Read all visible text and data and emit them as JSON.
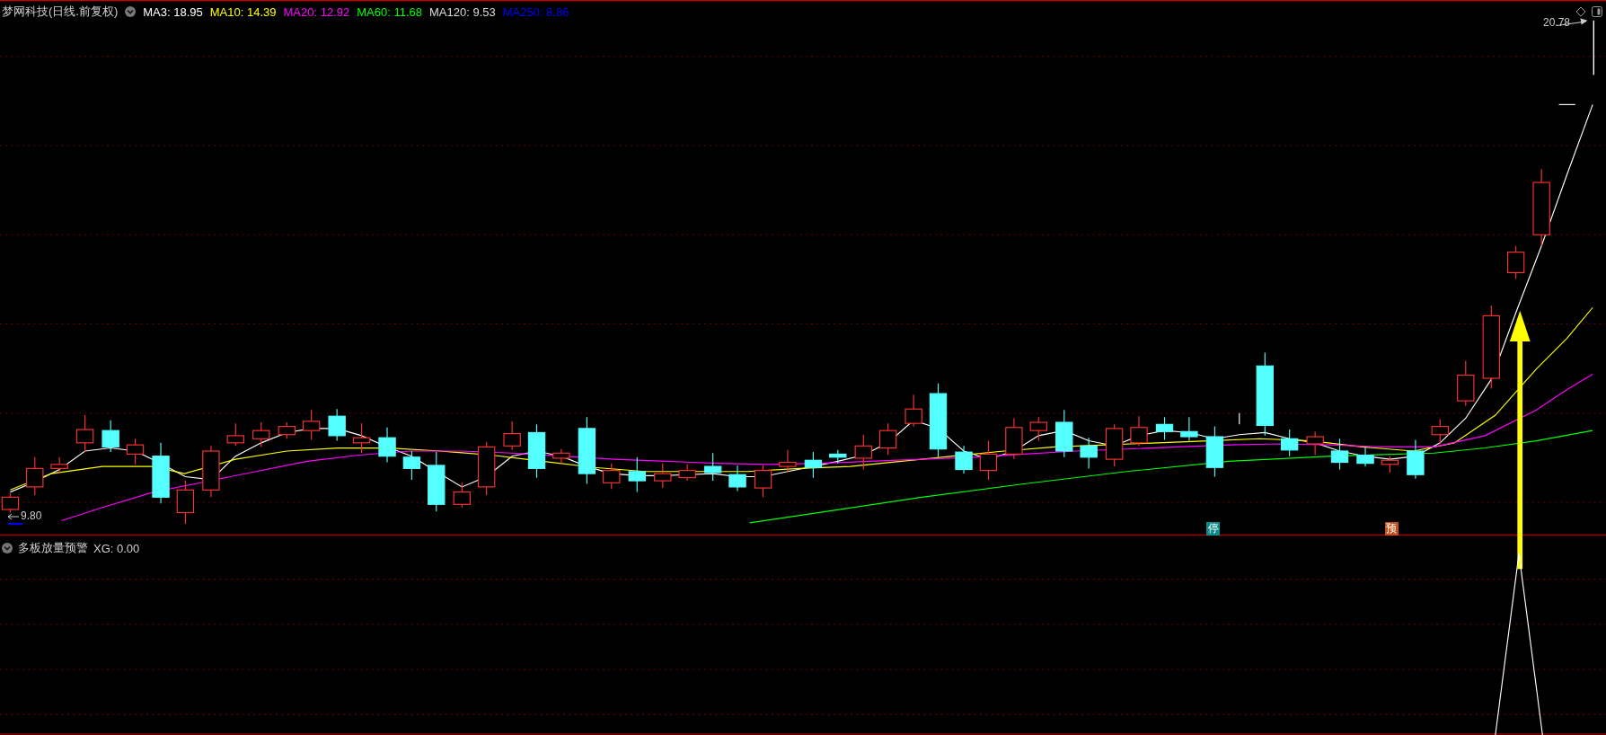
{
  "main_pane": {
    "title": "梦网科技(日线.前复权)",
    "indicators": [
      {
        "label": "MA3: 18.95",
        "color": "#ffffff"
      },
      {
        "label": "MA10: 14.39",
        "color": "#ffff00"
      },
      {
        "label": "MA20: 12.92",
        "color": "#ff00ff"
      },
      {
        "label": "MA60: 11.68",
        "color": "#00ff00"
      },
      {
        "label": "MA120: 9.53",
        "color": "#dcdcdc"
      },
      {
        "label": "MA250: 8.86",
        "color": "#0000ff"
      }
    ],
    "high_label": "20.78",
    "low_label": "9.80",
    "markers": [
      {
        "text": "停",
        "color": "#0e8a8a"
      },
      {
        "text": "预",
        "color": "#c0501a"
      }
    ]
  },
  "sub_pane": {
    "title": "多板放量预警",
    "reading": "XG: 0.00"
  }
}
